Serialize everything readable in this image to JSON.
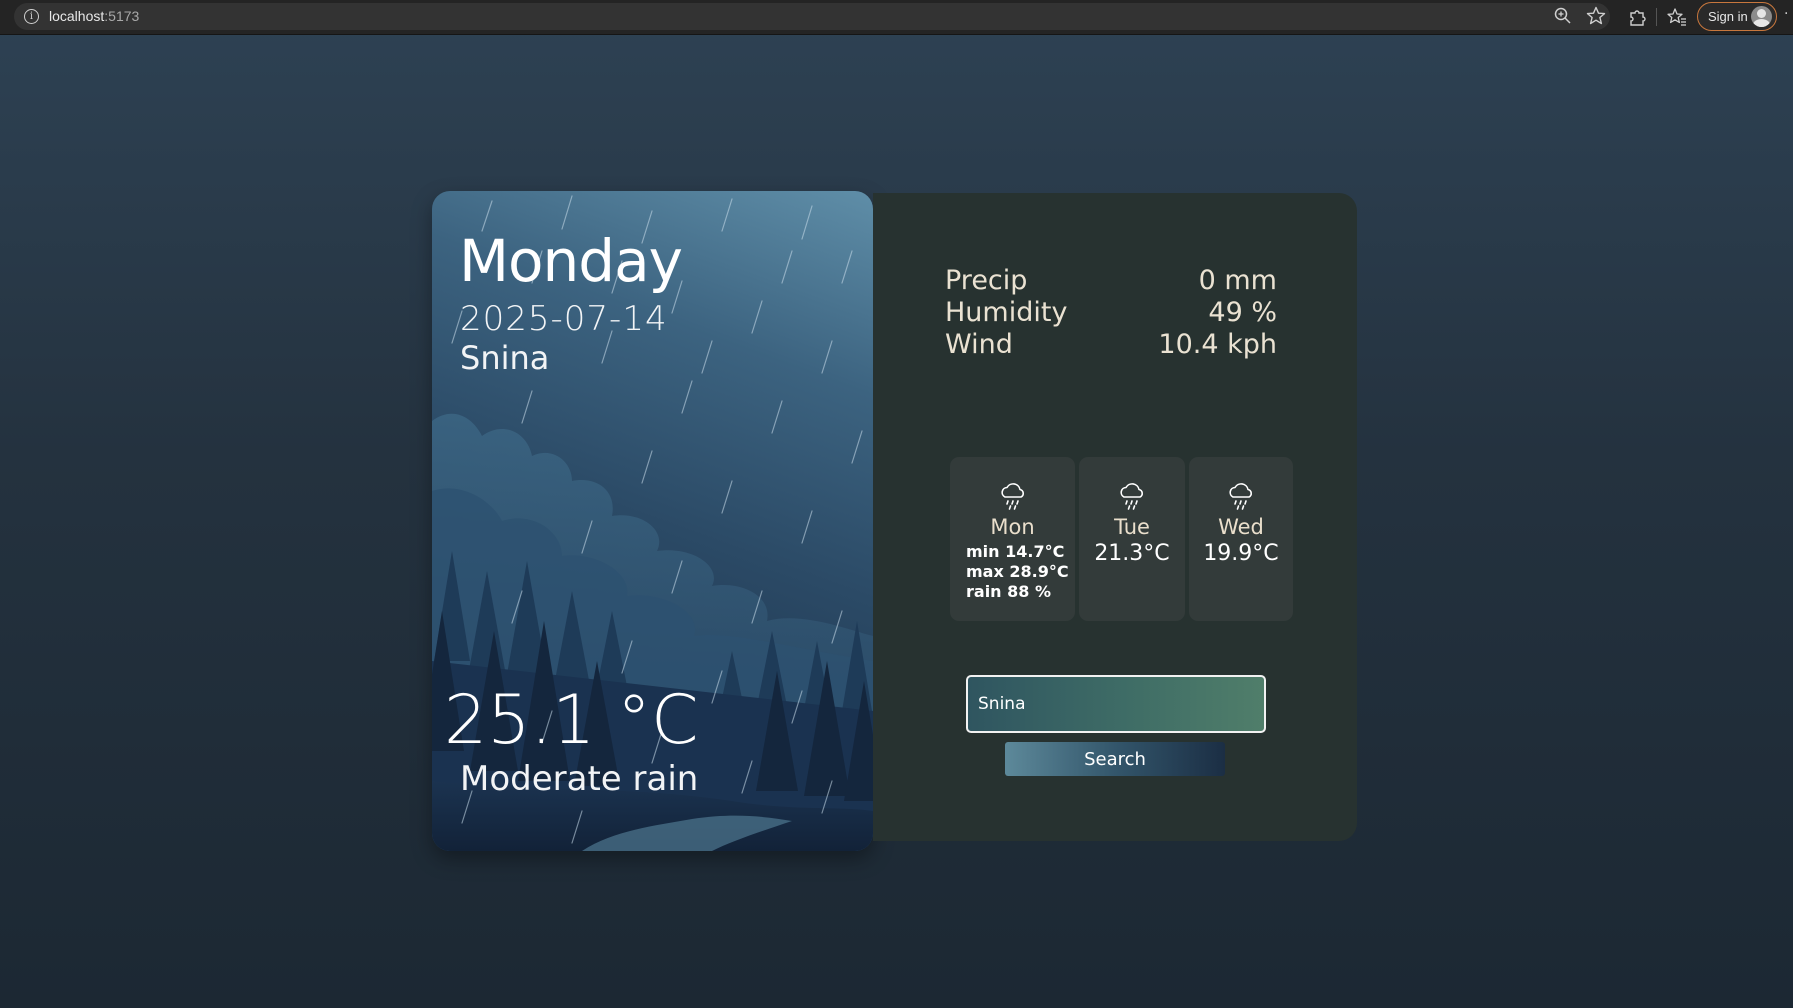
{
  "browser": {
    "url_host": "localhost",
    "url_port": ":5173",
    "signin_label": "Sign in"
  },
  "current": {
    "day": "Monday",
    "date": "2025-07-14",
    "city": "Snina",
    "temperature": "25.1 °C",
    "condition": "Moderate rain"
  },
  "stats": [
    {
      "label": "Precip",
      "value": "0 mm"
    },
    {
      "label": "Humidity",
      "value": "49 %"
    },
    {
      "label": "Wind",
      "value": "10.4 kph"
    }
  ],
  "forecast": [
    {
      "day": "Mon",
      "icon": "rain-cloud-icon",
      "min": "min 14.7°C",
      "max": "max 28.9°C",
      "rain": "rain 88 %"
    },
    {
      "day": "Tue",
      "icon": "rain-cloud-icon",
      "temp": "21.3°C"
    },
    {
      "day": "Wed",
      "icon": "rain-cloud-icon",
      "temp": "19.9°C"
    }
  ],
  "search": {
    "value": "Snina",
    "button_label": "Search"
  },
  "colors": {
    "page_background": "#24323f",
    "right_panel": "#273230",
    "forecast_box": "#333b3a",
    "text_warm": "#eae2d2",
    "signin_border": "#c8773d"
  }
}
